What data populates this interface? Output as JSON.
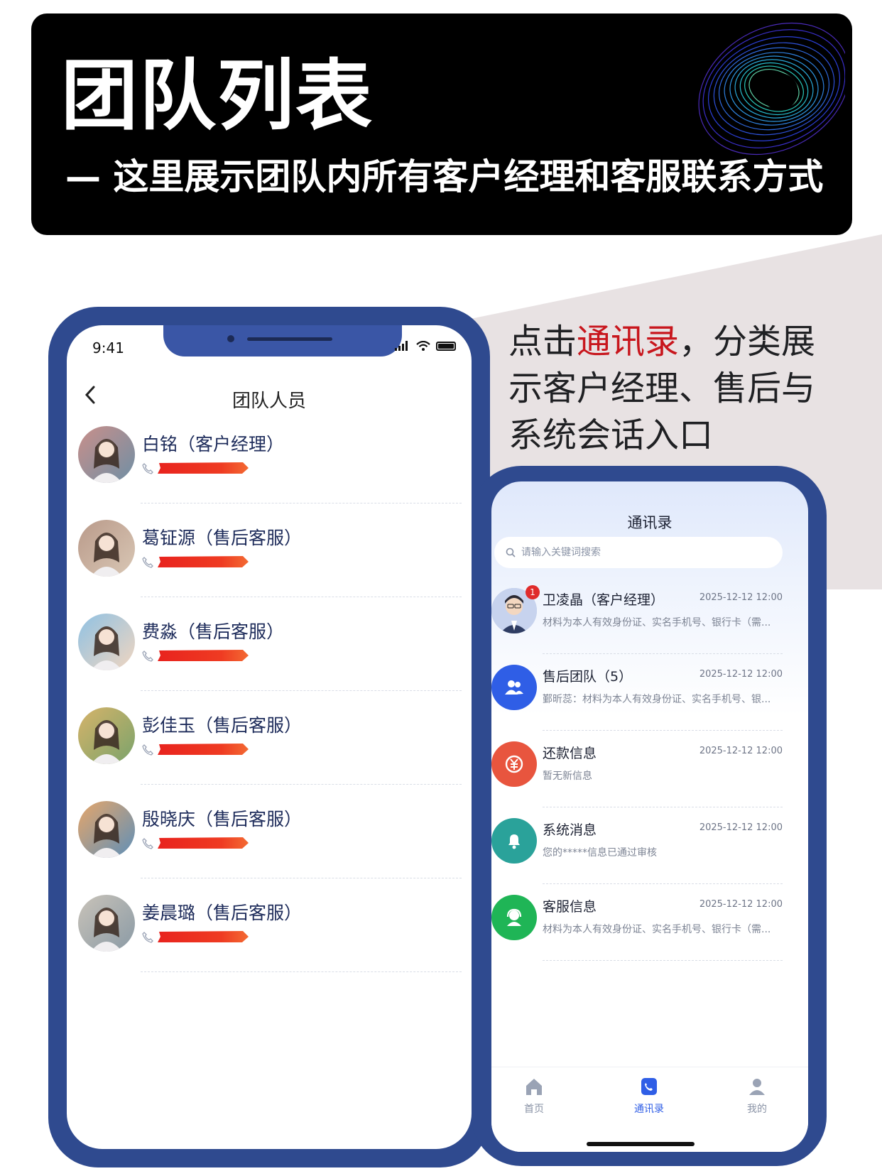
{
  "banner": {
    "title": "团队列表",
    "subtitle": "— 这里展示团队内所有客户经理和客服联系方式"
  },
  "description": {
    "prefix": "点击",
    "highlight": "通讯录",
    "suffix": "，分类展示客户经理、售后与系统会话入口",
    "highlight_color": "#c8161d"
  },
  "left_phone": {
    "status_time": "9:41",
    "nav_title": "团队人员",
    "members": [
      {
        "name": "白铭（客户经理）"
      },
      {
        "name": "葛钲源（售后客服）"
      },
      {
        "name": "费淼（售后客服）"
      },
      {
        "name": "彭佳玉（售后客服）"
      },
      {
        "name": "殷晓庆（售后客服）"
      },
      {
        "name": "姜晨璐（售后客服）"
      }
    ]
  },
  "right_phone": {
    "title": "通讯录",
    "search_placeholder": "请输入关键词搜索",
    "conversations": [
      {
        "name": "卫凌晶（客户经理）",
        "time": "2025-12-12  12:00",
        "message": "材料为本人有效身份证、实名手机号、银行卡（需...",
        "badge": "1",
        "icon": "person-avatar",
        "color": "#b8c6e6"
      },
      {
        "name": "售后团队（5）",
        "time": "2025-12-12  12:00",
        "message": "鄞昕蕊：材料为本人有效身份证、实名手机号、银...",
        "icon": "group-icon",
        "color": "#2f5ee6"
      },
      {
        "name": "还款信息",
        "time": "2025-12-12  12:00",
        "message": "暂无新信息",
        "icon": "yuan-icon",
        "color": "#e8553e"
      },
      {
        "name": "系统消息",
        "time": "2025-12-12  12:00",
        "message": "您的*****信息已通过审核",
        "icon": "bell-icon",
        "color": "#2aa29a"
      },
      {
        "name": "客服信息",
        "time": "2025-12-12  12:00",
        "message": "材料为本人有效身份证、实名手机号、银行卡（需...",
        "icon": "headset-icon",
        "color": "#1fb556"
      }
    ],
    "tabs": [
      {
        "label": "首页",
        "icon": "home-icon",
        "active": false
      },
      {
        "label": "通讯录",
        "icon": "contacts-icon",
        "active": true
      },
      {
        "label": "我的",
        "icon": "user-icon",
        "active": false
      }
    ],
    "accent_color": "#2f5ee6"
  }
}
